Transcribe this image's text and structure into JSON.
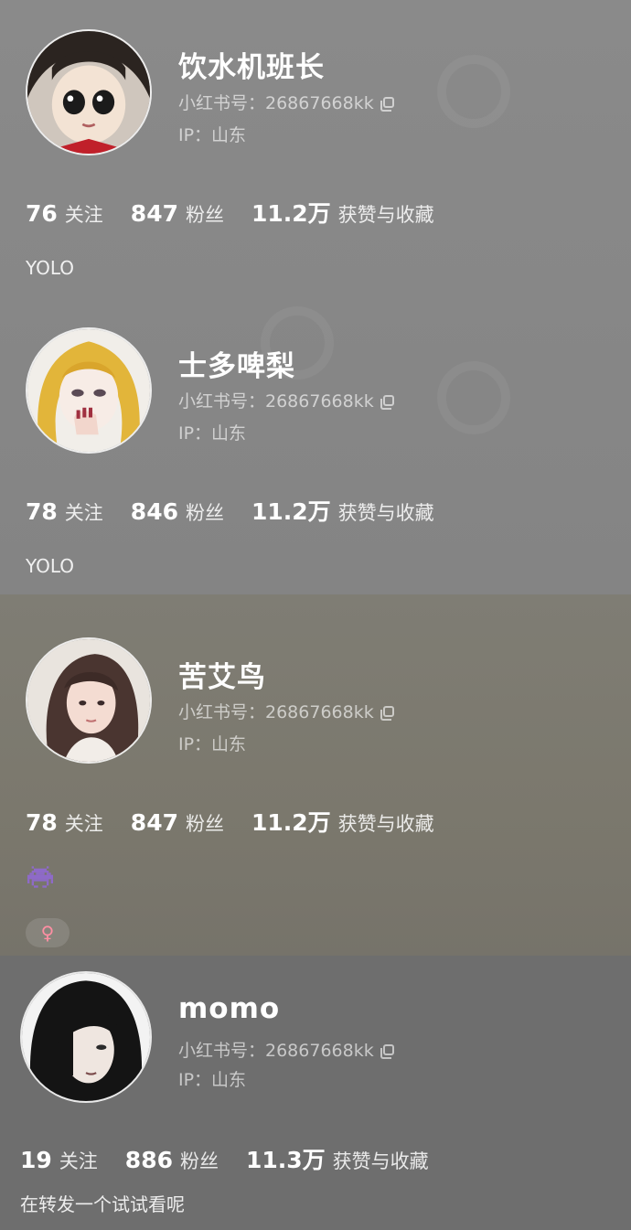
{
  "profiles": [
    {
      "name": "饮水机班长",
      "id_line": "小红书号：26867668kk",
      "ip_line": "IP：山东",
      "following": "76",
      "following_label": "关注",
      "followers": "847",
      "followers_label": "粉丝",
      "likes": "11.2万",
      "likes_label": "获赞与收藏",
      "bio": "YOLO"
    },
    {
      "name": "士多啤梨",
      "id_line": "小红书号：26867668kk",
      "ip_line": "IP：山东",
      "following": "78",
      "following_label": "关注",
      "followers": "846",
      "followers_label": "粉丝",
      "likes": "11.2万",
      "likes_label": "获赞与收藏",
      "bio": "YOLO"
    },
    {
      "name": "苦艾鸟",
      "id_line": "小红书号：26867668kk",
      "ip_line": "IP：山东",
      "following": "78",
      "following_label": "关注",
      "followers": "847",
      "followers_label": "粉丝",
      "likes": "11.2万",
      "likes_label": "获赞与收藏",
      "bio_icon": "purple-alien-monster-icon",
      "gender": "♀"
    },
    {
      "name": "momo",
      "id_line": "小红书号：26867668kk",
      "ip_line": "IP：山东",
      "following": "19",
      "following_label": "关注",
      "followers": "886",
      "followers_label": "粉丝",
      "likes": "11.3万",
      "likes_label": "获赞与收藏",
      "bio": "在转发一个试试看呢"
    }
  ]
}
